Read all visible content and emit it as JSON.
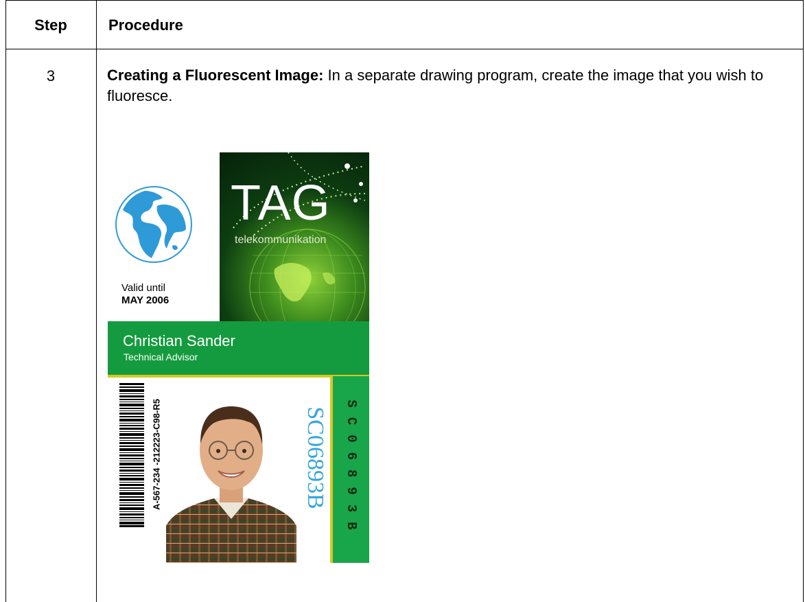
{
  "table": {
    "header_step": "Step",
    "header_procedure": "Procedure",
    "row": {
      "step_number": "3",
      "title": "Creating a Fluorescent Image:",
      "text": " In a separate drawing program, create the image that you wish to fluoresce."
    }
  },
  "card": {
    "valid_label": "Valid until",
    "valid_date": "MAY 2006",
    "brand": "TAG",
    "brand_sub": "telekommunikation",
    "name": "Christian Sander",
    "title": "Technical Advisor",
    "barcode_text": "A-567-234 -212223-C98-R5",
    "serial_large": "SC06893B",
    "serial_stripe": "SC06893B",
    "colors": {
      "green": "#159b3f",
      "yellow": "#d8c721",
      "blue": "#35a6de"
    }
  }
}
